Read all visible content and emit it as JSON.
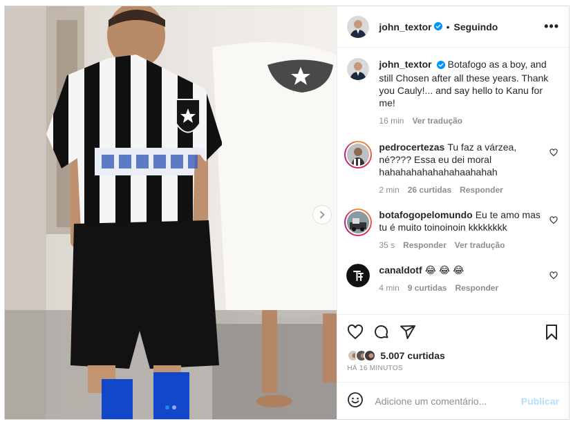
{
  "post": {
    "author": "john_textor",
    "following_label": "Seguindo",
    "more_label": "•••",
    "separator": "•"
  },
  "caption": {
    "username": "john_textor",
    "text": "Botafogo as a boy, and still Chosen after all these years. Thank you Cauly!... and say hello to Kanu for me!",
    "time": "16 min",
    "translate": "Ver tradução"
  },
  "comments": [
    {
      "username": "pedrocertezas",
      "text": "Tu faz a várzea, né???? Essa eu dei moral hahahahahahahahaahahah",
      "time": "2 min",
      "likes": "26 curtidas",
      "reply": "Responder"
    },
    {
      "username": "botafogopelomundo",
      "text": "Eu te amo mas tu é muito toinoinoin kkkkkkkk",
      "time": "35 s",
      "reply": "Responder",
      "translate": "Ver tradução"
    },
    {
      "username": "canaldotf",
      "text": "😂 😂 😂",
      "time": "4 min",
      "likes": "9 curtidas",
      "reply": "Responder"
    }
  ],
  "engagement": {
    "likes_count": "5.007 curtidas",
    "time_ago": "HÁ 16 MINUTOS"
  },
  "add_comment": {
    "placeholder": "Adicione um comentário...",
    "publish_label": "Publicar"
  },
  "carousel": {
    "total": 2,
    "current": 1
  },
  "colors": {
    "accent": "#0095f6",
    "publish_disabled": "#b2dffc",
    "verified": "#0095f6"
  }
}
